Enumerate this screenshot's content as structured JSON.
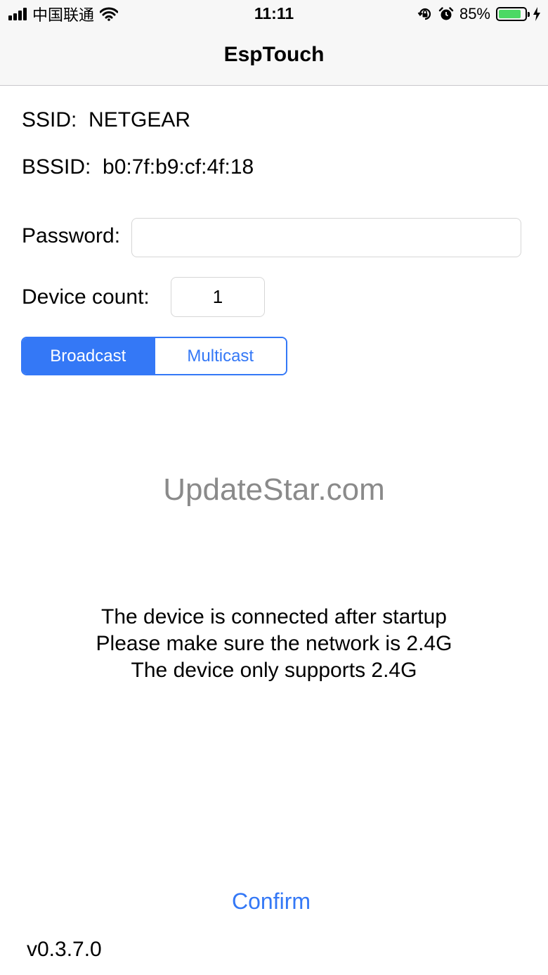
{
  "status_bar": {
    "carrier": "中国联通",
    "time": "11:11",
    "battery_percent": "85%",
    "battery_level": 0.85,
    "icons": [
      "signal-icon",
      "wifi-icon",
      "rotation-lock-icon",
      "alarm-icon",
      "battery-icon",
      "charging-icon"
    ]
  },
  "nav": {
    "title": "EspTouch"
  },
  "ssid": {
    "label": "SSID:",
    "value": "NETGEAR"
  },
  "bssid": {
    "label": "BSSID:",
    "value": "b0:7f:b9:cf:4f:18"
  },
  "password": {
    "label": "Password:",
    "value": "",
    "placeholder": ""
  },
  "device_count": {
    "label": "Device count:",
    "value": "1"
  },
  "mode": {
    "options": [
      "Broadcast",
      "Multicast"
    ],
    "selected": "Broadcast"
  },
  "watermark": "UpdateStar.com",
  "info_lines": [
    "The device is connected after startup",
    "Please make sure the network is 2.4G",
    "The device only supports 2.4G"
  ],
  "confirm_label": "Confirm",
  "version": "v0.3.7.0",
  "colors": {
    "accent": "#3478f6",
    "battery": "#4cd964",
    "watermark": "#8a8a8a",
    "nav_background": "#f7f7f7"
  }
}
